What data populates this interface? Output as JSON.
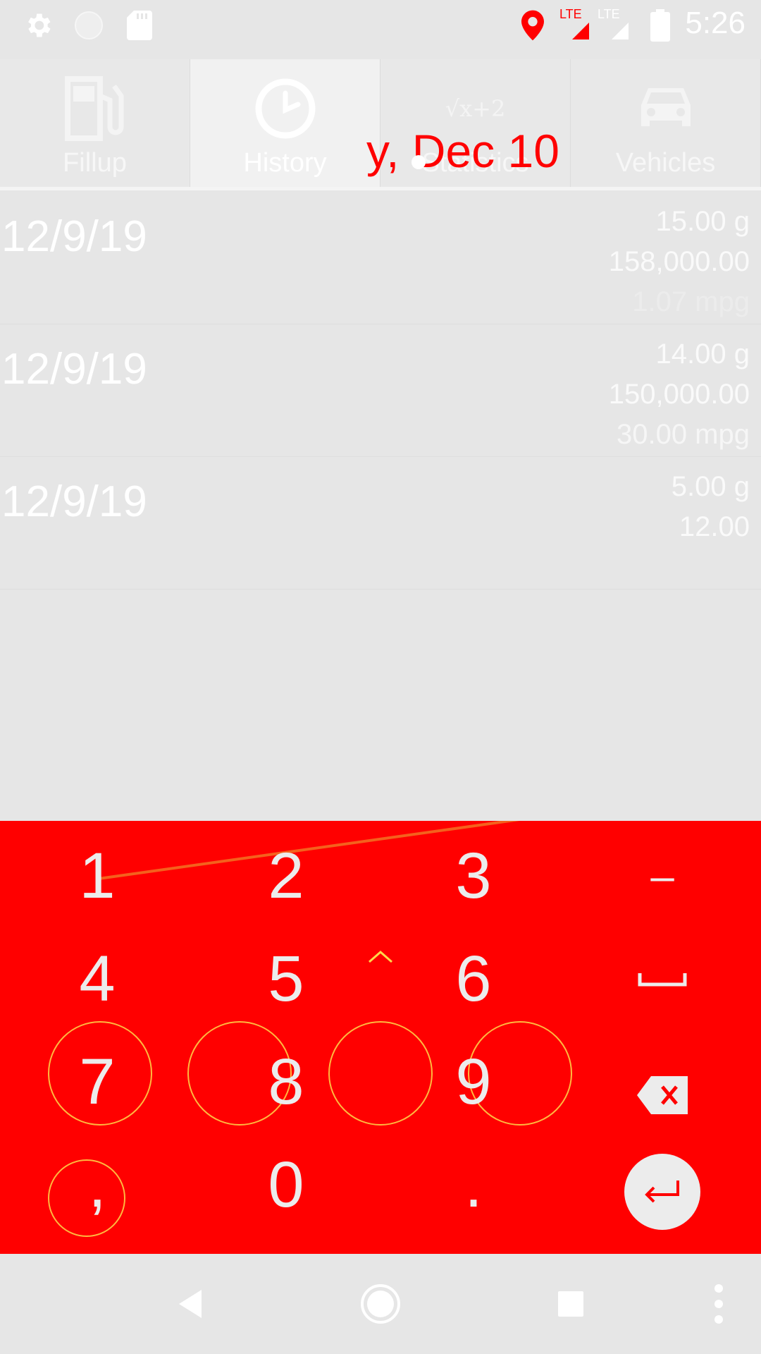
{
  "status_bar": {
    "time": "5:26",
    "icons": [
      "settings-icon",
      "circle-icon",
      "sd-card-icon",
      "location-icon",
      "lte-signal-icon",
      "lte-signal-icon",
      "battery-icon"
    ],
    "lte_label": "LTE"
  },
  "tabs": [
    {
      "label": "Fillup",
      "icon": "fuel-pump-icon",
      "active": false
    },
    {
      "label": "History",
      "icon": "clock-icon",
      "active": true
    },
    {
      "label": "Statistics",
      "icon": "sqrt-formula-icon",
      "active": false
    },
    {
      "label": "Vehicles",
      "icon": "car-icon",
      "active": false
    }
  ],
  "tab_icon_formula": "√x+2",
  "overlay": {
    "date_text": "y, Dec 10"
  },
  "history": [
    {
      "date": "12/9/19",
      "gallons": "15.00 g",
      "odometer": "158,000.00",
      "mpg": "1.07 mpg"
    },
    {
      "date": "12/9/19",
      "gallons": "14.00 g",
      "odometer": "150,000.00",
      "mpg": "30.00 mpg"
    },
    {
      "date": "12/9/19",
      "gallons": "5.00 g",
      "odometer": "12.00",
      "mpg": ""
    }
  ],
  "keypad": {
    "keys": [
      "1",
      "2",
      "3",
      "–",
      "4",
      "5",
      "6",
      "␣",
      "7",
      "8",
      "9",
      "⌫",
      ",",
      "0",
      ".",
      "↵"
    ]
  },
  "colors": {
    "keypad_bg": "#ff0000",
    "background": "#e6e6e6",
    "ghost_outline": "#ffd84a"
  }
}
